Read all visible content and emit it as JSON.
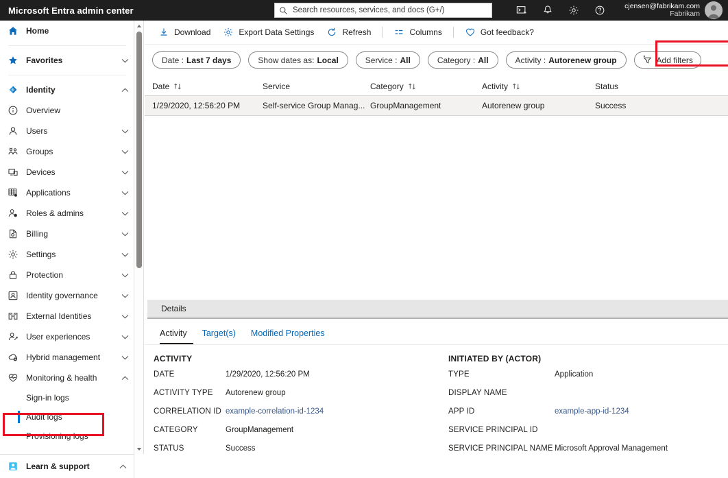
{
  "topbar": {
    "brand": "Microsoft Entra admin center",
    "search_placeholder": "Search resources, services, and docs (G+/)",
    "icons": [
      {
        "name": "cloud-shell-icon",
        "glyph": "shell"
      },
      {
        "name": "notifications-bell-icon",
        "glyph": "bell"
      },
      {
        "name": "settings-gear-icon",
        "glyph": "gear"
      },
      {
        "name": "help-question-icon",
        "glyph": "help"
      }
    ],
    "account_email": "cjensen@fabrikam.com",
    "account_tenant": "Fabrikam"
  },
  "sidebar": {
    "items": [
      {
        "label": "Home",
        "icon": "home-icon",
        "level": "top",
        "chevron": "none"
      },
      {
        "label": "Favorites",
        "icon": "star-icon",
        "level": "top",
        "chevron": "down"
      },
      {
        "label": "Identity",
        "icon": "identity-diamond-icon",
        "level": "top",
        "chevron": "up"
      },
      {
        "label": "Overview",
        "icon": "info-circle-icon",
        "level": "child",
        "chevron": "none"
      },
      {
        "label": "Users",
        "icon": "user-icon",
        "level": "child",
        "chevron": "down"
      },
      {
        "label": "Groups",
        "icon": "groups-icon",
        "level": "child",
        "chevron": "down"
      },
      {
        "label": "Devices",
        "icon": "devices-icon",
        "level": "child",
        "chevron": "down"
      },
      {
        "label": "Applications",
        "icon": "applications-grid-icon",
        "level": "child",
        "chevron": "down"
      },
      {
        "label": "Roles & admins",
        "icon": "roles-admins-icon",
        "level": "child",
        "chevron": "down"
      },
      {
        "label": "Billing",
        "icon": "billing-document-icon",
        "level": "child",
        "chevron": "down"
      },
      {
        "label": "Settings",
        "icon": "gear-icon",
        "level": "child",
        "chevron": "down"
      },
      {
        "label": "Protection",
        "icon": "lock-icon",
        "level": "child",
        "chevron": "down"
      },
      {
        "label": "Identity governance",
        "icon": "identity-governance-icon",
        "level": "child",
        "chevron": "down"
      },
      {
        "label": "External Identities",
        "icon": "external-identities-icon",
        "level": "child",
        "chevron": "down"
      },
      {
        "label": "User experiences",
        "icon": "user-experiences-icon",
        "level": "child",
        "chevron": "down"
      },
      {
        "label": "Hybrid management",
        "icon": "hybrid-cloud-icon",
        "level": "child",
        "chevron": "down"
      },
      {
        "label": "Monitoring & health",
        "icon": "heart-monitor-icon",
        "level": "child",
        "chevron": "up"
      },
      {
        "label": "Sign-in logs",
        "icon": "none",
        "level": "leaf",
        "chevron": "none"
      },
      {
        "label": "Audit logs",
        "icon": "none",
        "level": "leaf",
        "chevron": "none",
        "selected": true
      },
      {
        "label": "Provisioning logs",
        "icon": "none",
        "level": "leaf",
        "chevron": "none"
      }
    ],
    "footer": {
      "label": "Learn & support",
      "icon": "learn-support-icon",
      "chevron": "up"
    },
    "selected_accent": "#0078d4",
    "highlight_color": "#e81123"
  },
  "toolbar": {
    "commands": [
      {
        "label": "Download",
        "icon": "download-icon"
      },
      {
        "label": "Export Data Settings",
        "icon": "gear-icon"
      },
      {
        "label": "Refresh",
        "icon": "refresh-icon"
      },
      {
        "label": "Columns",
        "icon": "columns-icon"
      },
      {
        "label": "Got feedback?",
        "icon": "heart-icon"
      }
    ]
  },
  "filters": [
    {
      "key": "Date :",
      "value": "Last 7 days",
      "name": "filter-date"
    },
    {
      "key": "Show dates as:",
      "value": "Local",
      "name": "filter-show-dates-as"
    },
    {
      "key": "Service :",
      "value": "All",
      "name": "filter-service"
    },
    {
      "key": "Category :",
      "value": "All",
      "name": "filter-category"
    },
    {
      "key": "Activity :",
      "value": "Autorenew group",
      "name": "filter-activity",
      "highlighted": true
    }
  ],
  "add_filters_label": "Add filters",
  "table": {
    "columns": [
      {
        "label": "Date",
        "sortable": true
      },
      {
        "label": "Service",
        "sortable": false
      },
      {
        "label": "Category",
        "sortable": true
      },
      {
        "label": "Activity",
        "sortable": true
      },
      {
        "label": "Status",
        "sortable": false
      }
    ],
    "rows": [
      {
        "date": "1/29/2020, 12:56:20 PM",
        "service": "Self-service Group Manag...",
        "category": "GroupManagement",
        "activity": "Autorenew group",
        "status": "Success",
        "selected": true
      }
    ]
  },
  "details": {
    "bar_label": "Details",
    "tabs": [
      {
        "label": "Activity",
        "active": true
      },
      {
        "label": "Target(s)",
        "active": false
      },
      {
        "label": "Modified Properties",
        "active": false
      }
    ],
    "activity": {
      "heading": "ACTIVITY",
      "rows": [
        {
          "key": "DATE",
          "value": "1/29/2020, 12:56:20 PM",
          "link": false
        },
        {
          "key": "ACTIVITY TYPE",
          "value": "Autorenew group",
          "link": false
        },
        {
          "key": "CORRELATION ID",
          "value": "example-correlation-id-1234",
          "link": true
        },
        {
          "key": "CATEGORY",
          "value": "GroupManagement",
          "link": false
        },
        {
          "key": "STATUS",
          "value": "Success",
          "link": false
        }
      ]
    },
    "initiated_by": {
      "heading": "INITIATED BY (ACTOR)",
      "rows": [
        {
          "key": "TYPE",
          "value": "Application",
          "link": false
        },
        {
          "key": "DISPLAY NAME",
          "value": "",
          "link": false
        },
        {
          "key": "APP ID",
          "value": "example-app-id-1234",
          "link": true
        },
        {
          "key": "SERVICE PRINCIPAL ID",
          "value": "",
          "link": false
        },
        {
          "key": "SERVICE PRINCIPAL NAME",
          "value": "Microsoft Approval Management",
          "link": false
        }
      ]
    }
  }
}
